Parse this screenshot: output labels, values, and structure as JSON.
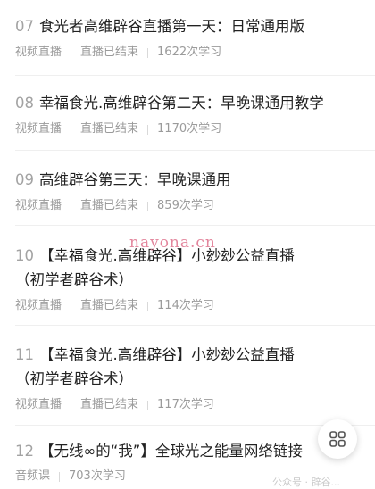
{
  "items": [
    {
      "num": "07",
      "title": "食光者高维辟谷直播第一天：日常通用版",
      "type": "视频直播",
      "status": "直播已结束",
      "views": "1622次学习"
    },
    {
      "num": "08",
      "title": "幸福食光.高维辟谷第二天：早晚课通用教学",
      "type": "视频直播",
      "status": "直播已结束",
      "views": "1170次学习"
    },
    {
      "num": "09",
      "title": "高维辟谷第三天：早晚课通用",
      "type": "视频直播",
      "status": "直播已结束",
      "views": "859次学习"
    },
    {
      "num": "10",
      "title": "【幸福食光.高维辟谷】小玅玅公益直播（初学者辟谷术）",
      "type": "视频直播",
      "status": "直播已结束",
      "views": "114次学习"
    },
    {
      "num": "11",
      "title": "【幸福食光.高维辟谷】小玅玅公益直播（初学者辟谷术）",
      "type": "视频直播",
      "status": "直播已结束",
      "views": "117次学习"
    },
    {
      "num": "12",
      "title": "【无线∞的“我”】全球光之能量网络链接",
      "type": "音频课",
      "views": "703次学习"
    }
  ],
  "watermark": "nayona.cn",
  "footer_mark": "公众号 · 辟谷...",
  "fab_icon": "grid-menu-icon"
}
